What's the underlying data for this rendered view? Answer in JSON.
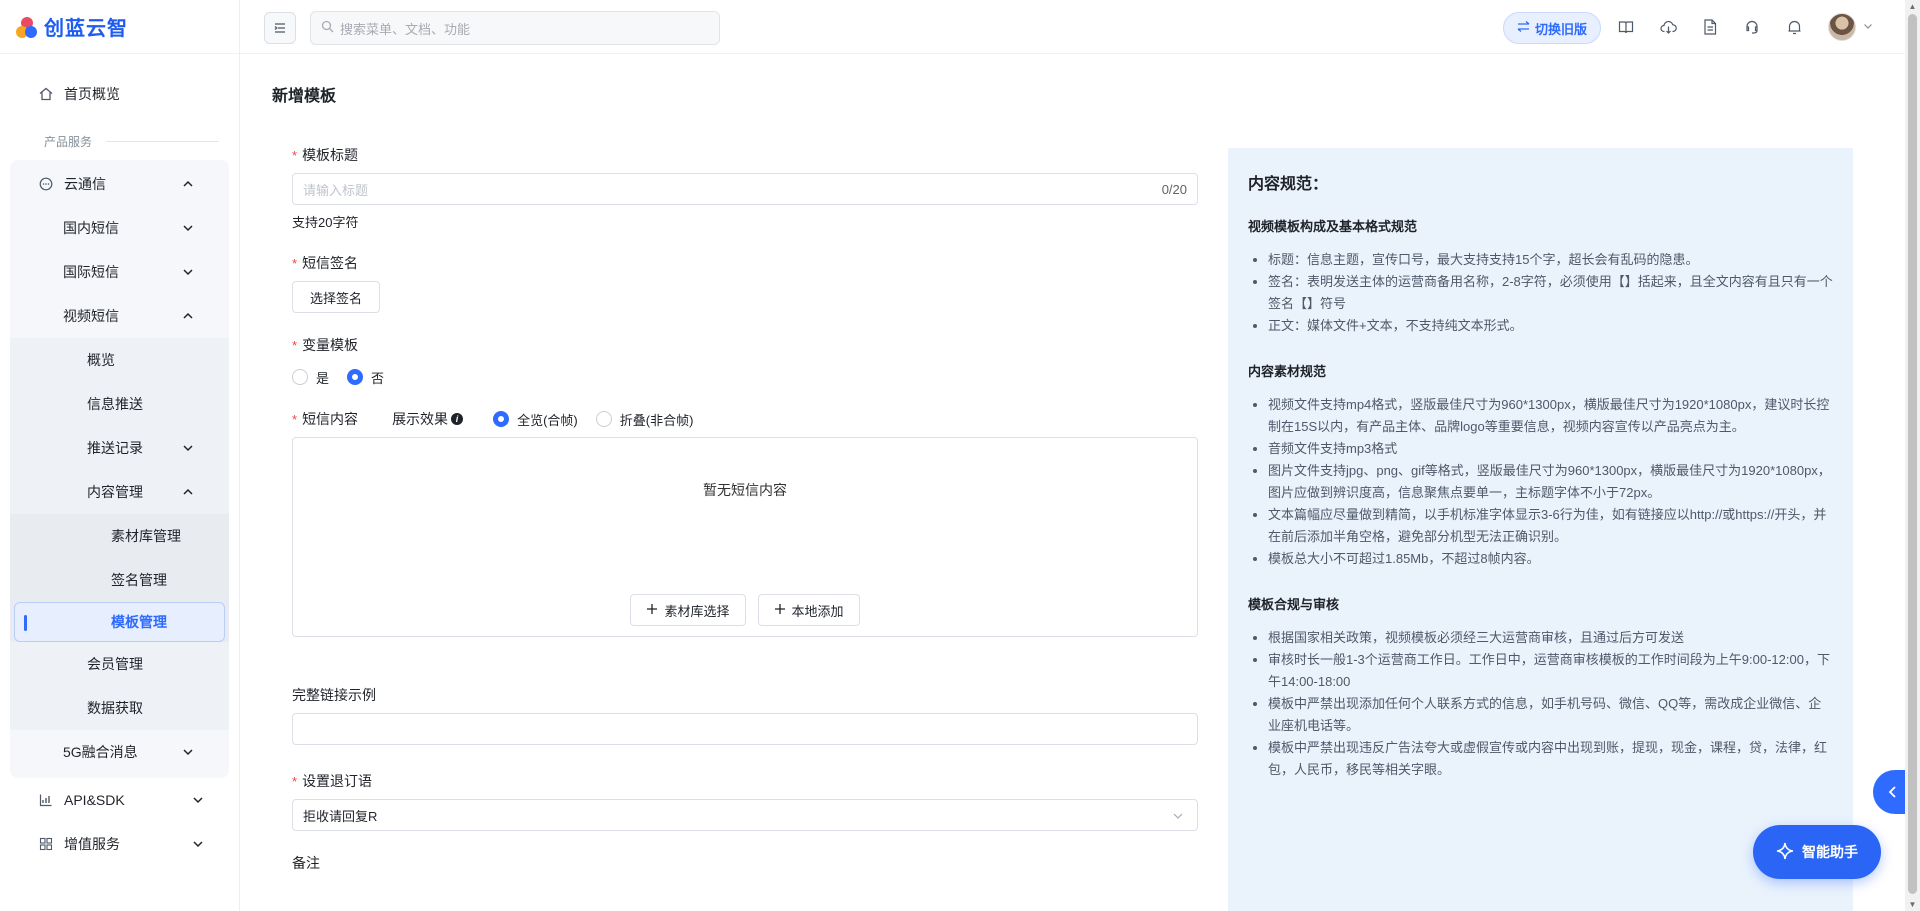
{
  "brand": {
    "name": "创蓝云智"
  },
  "sidebar": {
    "home": "首页概览",
    "group_title": "产品服务",
    "cloud_msg": "云通信",
    "domestic_sms": "国内短信",
    "intl_sms": "国际短信",
    "video_sms": "视频短信",
    "overview": "概览",
    "info_push": "信息推送",
    "push_records": "推送记录",
    "content_mgmt": "内容管理",
    "material_lib": "素材库管理",
    "signature_mgmt": "签名管理",
    "template_mgmt": "模板管理",
    "member_mgmt": "会员管理",
    "data_fetch": "数据获取",
    "fiveg_msg": "5G融合消息",
    "api_sdk": "API&SDK",
    "value_added": "增值服务"
  },
  "topbar": {
    "search_placeholder": "搜索菜单、文档、功能",
    "switch_old": "切换旧版"
  },
  "page": {
    "title": "新增模板",
    "form": {
      "title_label": "模板标题",
      "title_placeholder": "请输入标题",
      "title_count": "0/20",
      "title_hint": "支持20字符",
      "signature_label": "短信签名",
      "signature_button": "选择签名",
      "variable_label": "变量模板",
      "variable_yes": "是",
      "variable_no": "否",
      "variable_selected": "否",
      "content_label": "短信内容",
      "display_effect_label": "展示效果",
      "display_full": "全览(合帧)",
      "display_fold": "折叠(非合帧)",
      "display_selected": "全览(合帧)",
      "content_empty": "暂无短信内容",
      "material_select": "素材库选择",
      "local_add": "本地添加",
      "full_link_label": "完整链接示例",
      "unsubscribe_label": "设置退订语",
      "unsubscribe_value": "拒收请回复R",
      "remark_label": "备注"
    }
  },
  "guidelines": {
    "title": "内容规范：",
    "sections": [
      {
        "heading": "视频模板构成及基本格式规范",
        "items": [
          "标题：信息主题，宣传口号，最大支持支持15个字，超长会有乱码的隐患。",
          "签名：表明发送主体的运营商备用名称，2-8字符，必须使用【】括起来，且全文内容有且只有一个签名【】符号",
          "正文：媒体文件+文本，不支持纯文本形式。"
        ]
      },
      {
        "heading": "内容素材规范",
        "items": [
          "视频文件支持mp4格式，竖版最佳尺寸为960*1300px，横版最佳尺寸为1920*1080px，建议时长控制在15S以内，有产品主体、品牌logo等重要信息，视频内容宣传以产品亮点为主。",
          "音频文件支持mp3格式",
          "图片文件支持jpg、png、gif等格式，竖版最佳尺寸为960*1300px，横版最佳尺寸为1920*1080px，图片应做到辨识度高，信息聚焦点要单一，主标题字体不小于72px。",
          "文本篇幅应尽量做到精简，以手机标准字体显示3-6行为佳，如有链接应以http://或https://开头，并在前后添加半角空格，避免部分机型无法正确识别。",
          "模板总大小不可超过1.85Mb，不超过8帧内容。"
        ]
      },
      {
        "heading": "模板合规与审核",
        "items": [
          "根据国家相关政策，视频模板必须经三大运营商审核，且通过后方可发送",
          "审核时长一般1-3个运营商工作日。工作日中，运营商审核模板的工作时间段为上午9:00-12:00，下午14:00-18:00",
          "模板中严禁出现添加任何个人联系方式的信息，如手机号码、微信、QQ等，需改成企业微信、企业座机电话等。",
          "模板中严禁出现违反广告法夸大或虚假宣传或内容中出现到账，提现，现金，课程，贷，法律，红包，人民币，移民等相关字眼。"
        ]
      }
    ]
  },
  "assistant": {
    "label": "智能助手"
  },
  "colors": {
    "primary": "#2f6bff",
    "panel_bg": "#eaf3fc",
    "required": "#f53f3f"
  }
}
